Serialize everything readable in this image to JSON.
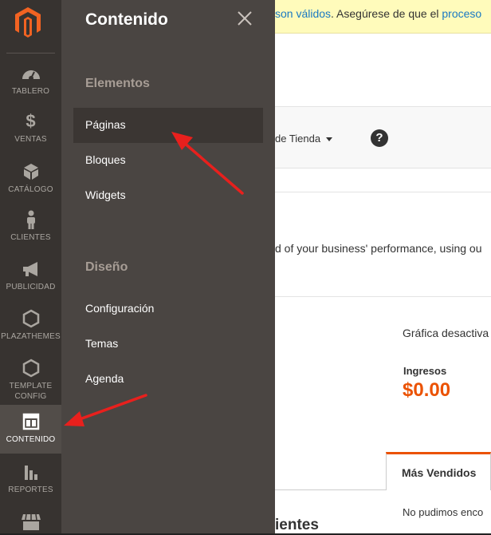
{
  "notice": {
    "text_pre": "son válidos",
    "text_mid": ". Asegúrese de que el ",
    "text_link": "proceso"
  },
  "toolbar": {
    "scope_label": "de Tienda",
    "help_glyph": "?"
  },
  "intro": {
    "text": "d of your business' performance, using ou"
  },
  "dashboard": {
    "chart_disabled": "Gráfica desactiva",
    "revenue_label": "Ingresos",
    "revenue_value": "$0.00",
    "tab_bestsellers": "Más Vendidos",
    "no_records": "No pudimos enco",
    "customers_heading": "ientes"
  },
  "nav": {
    "items": [
      {
        "label": "TABLERO",
        "icon": "dashboard-icon"
      },
      {
        "label": "VENTAS",
        "icon": "dollar-icon"
      },
      {
        "label": "CATÁLOGO",
        "icon": "box-icon"
      },
      {
        "label": "CLIENTES",
        "icon": "person-icon"
      },
      {
        "label": "PUBLICIDAD",
        "icon": "megaphone-icon"
      },
      {
        "label": "PLAZATHEMES",
        "icon": "hexagon-icon"
      },
      {
        "label_line1": "TEMPLATE",
        "label_line2": "CONFIG",
        "icon": "hexagon-icon"
      },
      {
        "label": "CONTENIDO",
        "icon": "layout-icon",
        "active": true
      },
      {
        "label": "REPORTES",
        "icon": "bar-chart-icon"
      },
      {
        "label": "",
        "icon": "store-icon"
      }
    ]
  },
  "flyout": {
    "title": "Contenido",
    "sections": [
      {
        "title": "Elementos",
        "links": [
          "Páginas",
          "Bloques",
          "Widgets"
        ]
      },
      {
        "title": "Diseño",
        "links": [
          "Configuración",
          "Temas",
          "Agenda"
        ]
      }
    ]
  },
  "colors": {
    "nav_bg": "#373330",
    "flyout_bg": "#4a4542",
    "accent": "#eb5202",
    "arrow": "#e8201d",
    "link": "#1979c3"
  }
}
